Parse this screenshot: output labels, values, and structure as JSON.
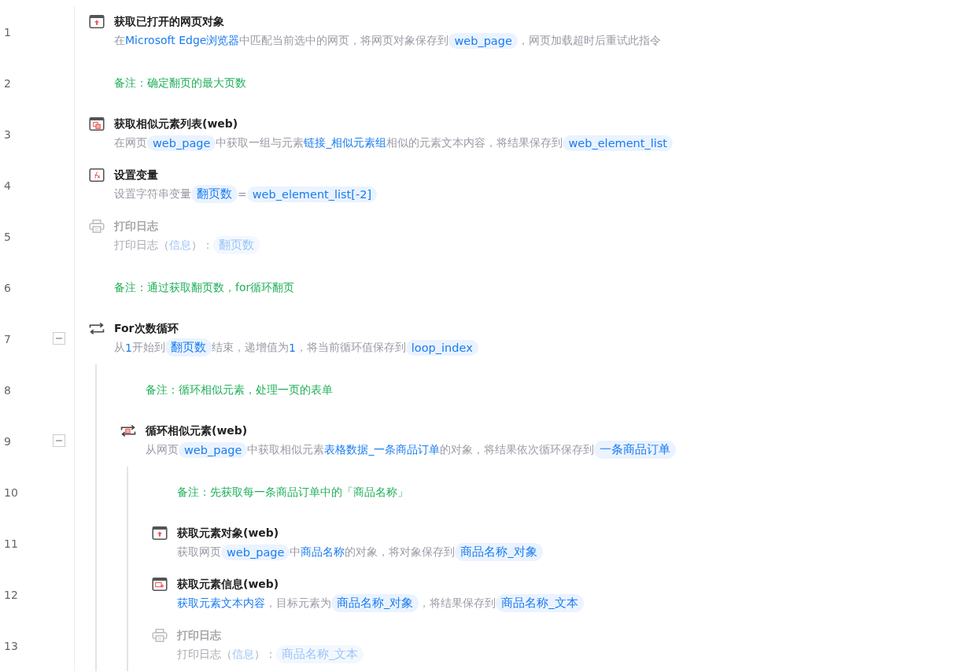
{
  "steps": [
    {
      "line": "1",
      "kind": "browser",
      "disabled": false,
      "title": "获取已打开的网页对象",
      "description": [
        {
          "kind": "text",
          "text": "在"
        },
        {
          "kind": "link",
          "text": "Microsoft Edge浏览器"
        },
        {
          "kind": "text",
          "text": "中匹配当前选中的网页，将网页对象保存到"
        },
        {
          "kind": "var",
          "text": "web_page"
        },
        {
          "kind": "text",
          "text": "，网页加载超时后重试此指令"
        }
      ]
    },
    {
      "line": "2",
      "kind": "comment",
      "text": "备注：确定翻页的最大页数"
    },
    {
      "line": "3",
      "kind": "element-list",
      "disabled": false,
      "title": "获取相似元素列表(web)",
      "description": [
        {
          "kind": "text",
          "text": "在网页"
        },
        {
          "kind": "var",
          "text": "web_page"
        },
        {
          "kind": "text",
          "text": "中获取一组与元素"
        },
        {
          "kind": "link",
          "text": "链接_相似元素组"
        },
        {
          "kind": "text",
          "text": "相似的元素文本内容，将结果保存到"
        },
        {
          "kind": "var",
          "text": "web_element_list"
        }
      ]
    },
    {
      "line": "4",
      "kind": "variable",
      "disabled": false,
      "title": "设置变量",
      "description": [
        {
          "kind": "text",
          "text": "设置字符串变量"
        },
        {
          "kind": "var",
          "text": "翻页数"
        },
        {
          "kind": "text",
          "text": "="
        },
        {
          "kind": "var",
          "text": "web_element_list[-2]"
        }
      ]
    },
    {
      "line": "5",
      "kind": "printer",
      "disabled": true,
      "title": "打印日志",
      "description": [
        {
          "kind": "text",
          "text": "打印日志（"
        },
        {
          "kind": "link",
          "text": "信息"
        },
        {
          "kind": "text",
          "text": "）："
        },
        {
          "kind": "var",
          "text": "翻页数"
        }
      ]
    },
    {
      "line": "6",
      "kind": "comment",
      "text": "备注：通过获取翻页数，for循环翻页"
    },
    {
      "line": "7",
      "kind": "loop",
      "disabled": false,
      "expanded": true,
      "title": "For次数循环",
      "description": [
        {
          "kind": "text",
          "text": "从"
        },
        {
          "kind": "link",
          "text": "1"
        },
        {
          "kind": "text",
          "text": "开始到"
        },
        {
          "kind": "var",
          "text": "翻页数"
        },
        {
          "kind": "text",
          "text": "结束，递增值为"
        },
        {
          "kind": "link",
          "text": "1"
        },
        {
          "kind": "text",
          "text": "，将当前循环值保存到"
        },
        {
          "kind": "var",
          "text": "loop_index"
        }
      ],
      "children": [
        {
          "line": "8",
          "kind": "comment",
          "text": "备注：循环相似元素，处理一页的表单"
        },
        {
          "line": "9",
          "kind": "loop-element",
          "disabled": false,
          "expanded": true,
          "title": "循环相似元素(web)",
          "description": [
            {
              "kind": "text",
              "text": "从网页"
            },
            {
              "kind": "var",
              "text": "web_page"
            },
            {
              "kind": "text",
              "text": "中获取相似元素"
            },
            {
              "kind": "link",
              "text": "表格数据_一条商品订单"
            },
            {
              "kind": "text",
              "text": "的对象，将结果依次循环保存到"
            },
            {
              "kind": "var",
              "text": "一条商品订单"
            }
          ],
          "children": [
            {
              "line": "10",
              "kind": "comment",
              "text": "备注：先获取每一条商品订单中的「商品名称」"
            },
            {
              "line": "11",
              "kind": "browser",
              "disabled": false,
              "title": "获取元素对象(web)",
              "description": [
                {
                  "kind": "text",
                  "text": "获取网页"
                },
                {
                  "kind": "var",
                  "text": "web_page"
                },
                {
                  "kind": "text",
                  "text": "中"
                },
                {
                  "kind": "link",
                  "text": "商品名称"
                },
                {
                  "kind": "text",
                  "text": "的对象，将对象保存到"
                },
                {
                  "kind": "var",
                  "text": "商品名称_对象"
                }
              ]
            },
            {
              "line": "12",
              "kind": "element-info",
              "disabled": false,
              "title": "获取元素信息(web)",
              "description": [
                {
                  "kind": "link",
                  "text": "获取元素文本内容"
                },
                {
                  "kind": "text",
                  "text": "，目标元素为"
                },
                {
                  "kind": "var",
                  "text": "商品名称_对象"
                },
                {
                  "kind": "text",
                  "text": "，将结果保存到"
                },
                {
                  "kind": "var",
                  "text": "商品名称_文本"
                }
              ]
            },
            {
              "line": "13",
              "kind": "printer",
              "disabled": true,
              "title": "打印日志",
              "description": [
                {
                  "kind": "text",
                  "text": "打印日志（"
                },
                {
                  "kind": "link",
                  "text": "信息"
                },
                {
                  "kind": "text",
                  "text": "）："
                },
                {
                  "kind": "var",
                  "text": "商品名称_文本"
                }
              ]
            }
          ]
        }
      ]
    }
  ]
}
